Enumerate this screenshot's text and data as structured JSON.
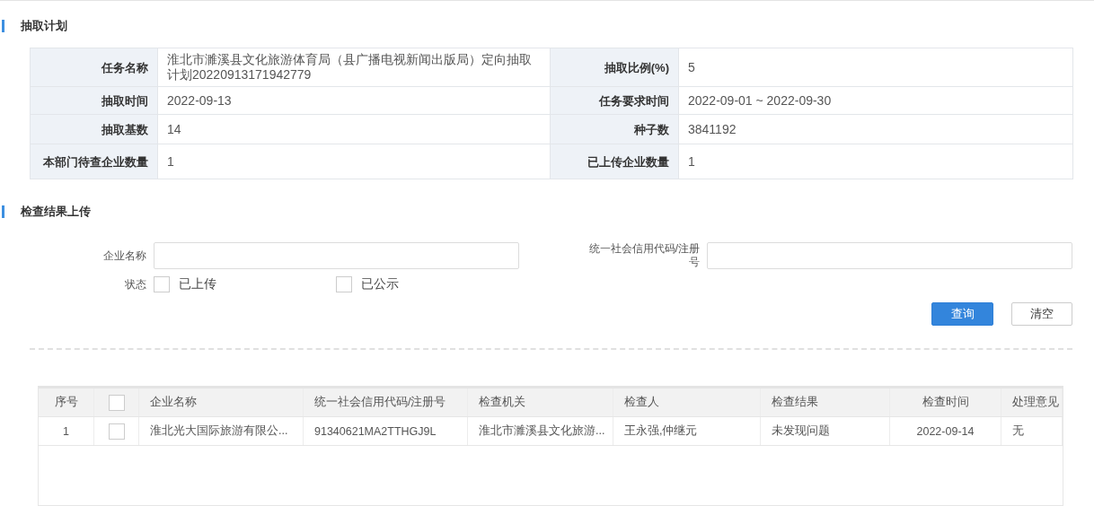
{
  "sections": [
    {
      "title": "抽取计划"
    },
    {
      "title": "检查结果上传"
    }
  ],
  "plan": [
    {
      "label": "任务名称",
      "value": "淮北市濉溪县文化旅游体育局（县广播电视新闻出版局）定向抽取计划20220913171942779",
      "label2": "抽取比例(%)",
      "value2": "5"
    },
    {
      "label": "抽取时间",
      "value": "2022-09-13",
      "label2": "任务要求时间",
      "value2": "2022-09-01 ~ 2022-09-30"
    },
    {
      "label": "抽取基数",
      "value": "14",
      "label2": "种子数",
      "value2": "3841192"
    },
    {
      "label": "本部门待查企业数量",
      "value": "1",
      "label2": "已上传企业数量",
      "value2": "1"
    }
  ],
  "form": {
    "fields": [
      {
        "label": "企业名称"
      },
      {
        "label": "统一社会信用代码/注册号"
      }
    ],
    "status_label": "状态",
    "options": [
      {
        "label": "已上传",
        "checked": false
      },
      {
        "label": "已公示",
        "checked": false
      }
    ],
    "buttons": [
      {
        "label": "查询",
        "kind": "primary"
      },
      {
        "label": "清空",
        "kind": "plain"
      }
    ]
  },
  "table": {
    "columns": [
      "序号",
      "",
      "企业名称",
      "统一社会信用代码/注册号",
      "检查机关",
      "检查人",
      "检查结果",
      "检查时间",
      "处理意见"
    ],
    "header_checked": false,
    "rows": [
      {
        "cells": [
          "1",
          "",
          "淮北光大国际旅游有限公...",
          "91340621MA2TTHGJ9L",
          "淮北市濉溪县文化旅游...",
          "王永强,仲继元",
          "未发现问题",
          "2022-09-14",
          "无"
        ],
        "checked": false
      }
    ]
  }
}
